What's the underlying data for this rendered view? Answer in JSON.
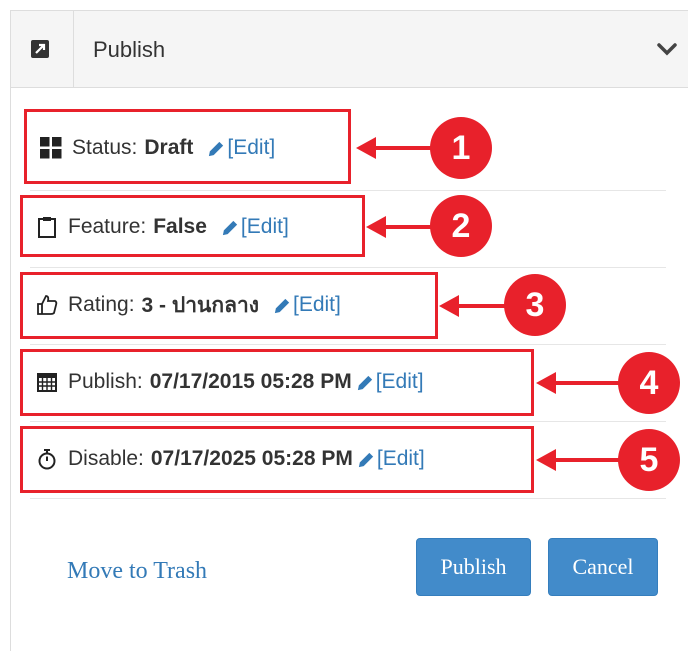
{
  "header": {
    "title": "Publish",
    "expand_icon": "external-link-square-icon",
    "collapse_icon": "chevron-down-icon"
  },
  "rows": [
    {
      "icon": "th-large-icon",
      "label": "Status:",
      "value": "Draft",
      "edit": "[Edit]",
      "badge": "1"
    },
    {
      "icon": "clipboard-icon",
      "label": "Feature:",
      "value": "False",
      "edit": "[Edit]",
      "badge": "2"
    },
    {
      "icon": "thumbs-up-icon",
      "label": "Rating:",
      "value": "3 - ปานกลาง",
      "edit": "[Edit]",
      "badge": "3"
    },
    {
      "icon": "calendar-icon",
      "label": "Publish:",
      "value": "07/17/2015 05:28 PM",
      "edit": "[Edit]",
      "badge": "4"
    },
    {
      "icon": "stopwatch-icon",
      "label": "Disable:",
      "value": "07/17/2025 05:28 PM",
      "edit": "[Edit]",
      "badge": "5"
    }
  ],
  "footer": {
    "trash_label": "Move to Trash",
    "publish_label": "Publish",
    "cancel_label": "Cancel"
  },
  "colors": {
    "annotation": "#e8212b",
    "link": "#337ab7",
    "button": "#428bca"
  }
}
